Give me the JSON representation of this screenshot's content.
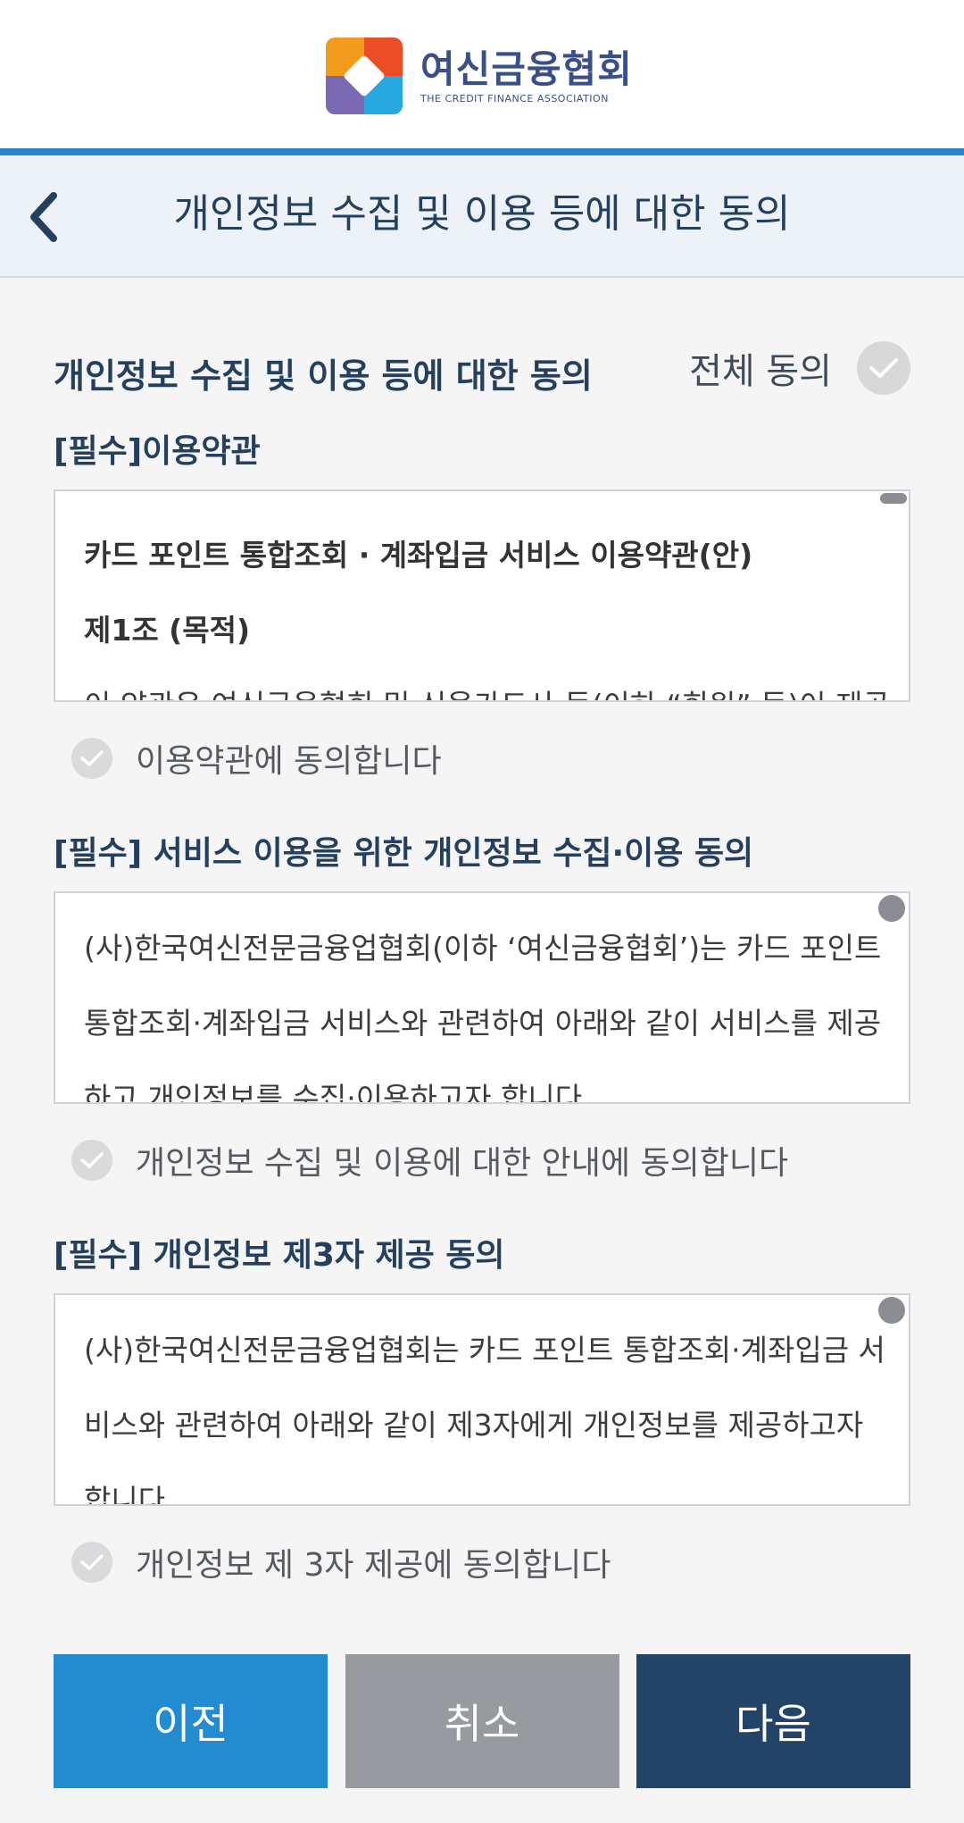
{
  "logo": {
    "korean_name": "여신금융협회",
    "english_name": "THE CREDIT FINANCE ASSOCIATION"
  },
  "topbar": {
    "title": "개인정보 수집 및 이용 등에 대한 동의"
  },
  "consent_section": {
    "title": "개인정보 수집 및 이용 등에 대한 동의",
    "all_agree_label": "전체 동의"
  },
  "terms": [
    {
      "title": "[필수]이용약관",
      "lines": [
        "카드 포인트 통합조회 · 계좌입금 서비스 이용약관(안)",
        "제1조 (목적)",
        "이 약관은 여신금융협회 및 신용카드사 등(이하 “회원” 등)이 제공"
      ],
      "agree_label": "이용약관에 동의합니다"
    },
    {
      "title": "[필수] 서비스 이용을 위한 개인정보 수집·이용 동의",
      "lines": [
        "(사)한국여신전문금융업협회(이하 ‘여신금융협회’)는 카드 포인트",
        "통합조회·계좌입금 서비스와 관련하여 아래와 같이 서비스를 제공",
        "하고 개인정보를 수집·이용하고자 합니다."
      ],
      "agree_label": "개인정보 수집 및 이용에 대한 안내에 동의합니다"
    },
    {
      "title": "[필수] 개인정보 제3자 제공 동의",
      "lines": [
        "(사)한국여신전문금융업협회는 카드 포인트 통합조회·계좌입금 서",
        "비스와 관련하여 아래와 같이 제3자에게 개인정보를 제공하고자",
        "합니다."
      ],
      "agree_label": "개인정보 제 3자 제공에 동의합니다"
    }
  ],
  "buttons": {
    "prev": "이전",
    "cancel": "취소",
    "next": "다음"
  },
  "colors": {
    "accent_blue": "#238bd0",
    "navy": "#234466",
    "gray_button": "#979a9e",
    "topbar_bg": "#edf1f8",
    "check_inactive": "#d7d8da"
  },
  "icons": {
    "back": "chevron-left-icon",
    "check": "check-icon"
  }
}
